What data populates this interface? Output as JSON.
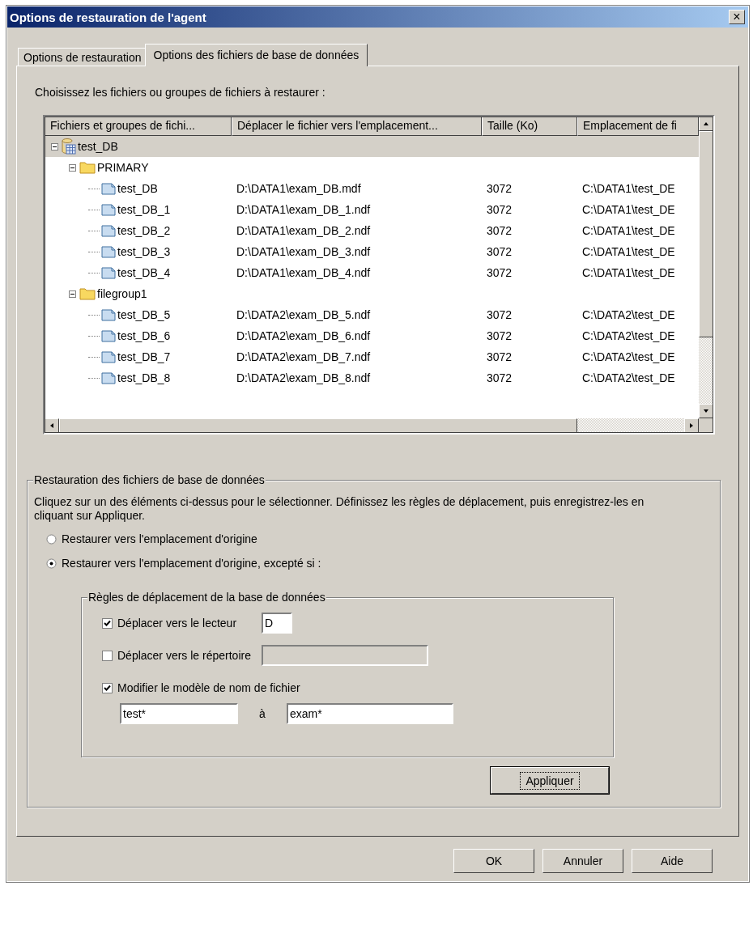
{
  "window": {
    "title": "Options de restauration de l'agent",
    "close": "×"
  },
  "tabs": [
    {
      "label": "Options de restauration",
      "selected": false
    },
    {
      "label": "Options des fichiers de base de données",
      "selected": true
    }
  ],
  "prompt": "Choisissez les fichiers ou groupes de fichiers à restaurer :",
  "tree": {
    "columns": [
      "Fichiers et groupes de fichi...",
      "Déplacer le fichier vers l'emplacement...",
      "Taille (Ko)",
      "Emplacement de fi"
    ],
    "items": [
      {
        "kind": "database",
        "name": "test_DB",
        "expanded": true,
        "selected": true,
        "children": [
          {
            "kind": "group",
            "name": "PRIMARY",
            "expanded": true,
            "selected": false,
            "children": [
              {
                "kind": "file",
                "name": "test_DB",
                "target": "D:\\DATA1\\exam_DB.mdf",
                "size": "3072",
                "location": "C:\\DATA1\\test_DE",
                "selected": false
              },
              {
                "kind": "file",
                "name": "test_DB_1",
                "target": "D:\\DATA1\\exam_DB_1.ndf",
                "size": "3072",
                "location": "C:\\DATA1\\test_DE",
                "selected": false
              },
              {
                "kind": "file",
                "name": "test_DB_2",
                "target": "D:\\DATA1\\exam_DB_2.ndf",
                "size": "3072",
                "location": "C:\\DATA1\\test_DE",
                "selected": false
              },
              {
                "kind": "file",
                "name": "test_DB_3",
                "target": "D:\\DATA1\\exam_DB_3.ndf",
                "size": "3072",
                "location": "C:\\DATA1\\test_DE",
                "selected": false
              },
              {
                "kind": "file",
                "name": "test_DB_4",
                "target": "D:\\DATA1\\exam_DB_4.ndf",
                "size": "3072",
                "location": "C:\\DATA1\\test_DE",
                "selected": false
              }
            ]
          },
          {
            "kind": "group",
            "name": "filegroup1",
            "expanded": true,
            "selected": false,
            "children": [
              {
                "kind": "file",
                "name": "test_DB_5",
                "target": "D:\\DATA2\\exam_DB_5.ndf",
                "size": "3072",
                "location": "C:\\DATA2\\test_DE",
                "selected": false
              },
              {
                "kind": "file",
                "name": "test_DB_6",
                "target": "D:\\DATA2\\exam_DB_6.ndf",
                "size": "3072",
                "location": "C:\\DATA2\\test_DE",
                "selected": false
              },
              {
                "kind": "file",
                "name": "test_DB_7",
                "target": "D:\\DATA2\\exam_DB_7.ndf",
                "size": "3072",
                "location": "C:\\DATA2\\test_DE",
                "selected": false
              },
              {
                "kind": "file",
                "name": "test_DB_8",
                "target": "D:\\DATA2\\exam_DB_8.ndf",
                "size": "3072",
                "location": "C:\\DATA2\\test_DE",
                "selected": false
              }
            ]
          }
        ]
      }
    ]
  },
  "restore": {
    "title": "Restauration des fichiers de base de données",
    "description": "Cliquez sur un des éléments ci-dessus pour le sélectionner. Définissez les règles de déplacement, puis enregistrez-les en cliquant sur Appliquer.",
    "options": [
      {
        "label": "Restaurer vers l'emplacement d'origine",
        "selected": false
      },
      {
        "label": "Restaurer vers l'emplacement d'origine, excepté si :",
        "selected": true
      }
    ],
    "rules": {
      "title": "Règles de déplacement de la base de données",
      "items": [
        {
          "kind": "drive",
          "label": "Déplacer vers le lecteur",
          "checked": true,
          "field": {
            "value": "D",
            "disabled": false
          }
        },
        {
          "kind": "directory",
          "label": "Déplacer vers le répertoire",
          "checked": false,
          "field": {
            "disabled": true
          }
        },
        {
          "kind": "pattern",
          "label": "Modifier le modèle de nom de fichier",
          "checked": true,
          "from": "test*",
          "joiner": "à",
          "to": "exam*"
        }
      ]
    },
    "apply": "Appliquer"
  },
  "buttons": [
    "OK",
    "Annuler",
    "Aide"
  ]
}
